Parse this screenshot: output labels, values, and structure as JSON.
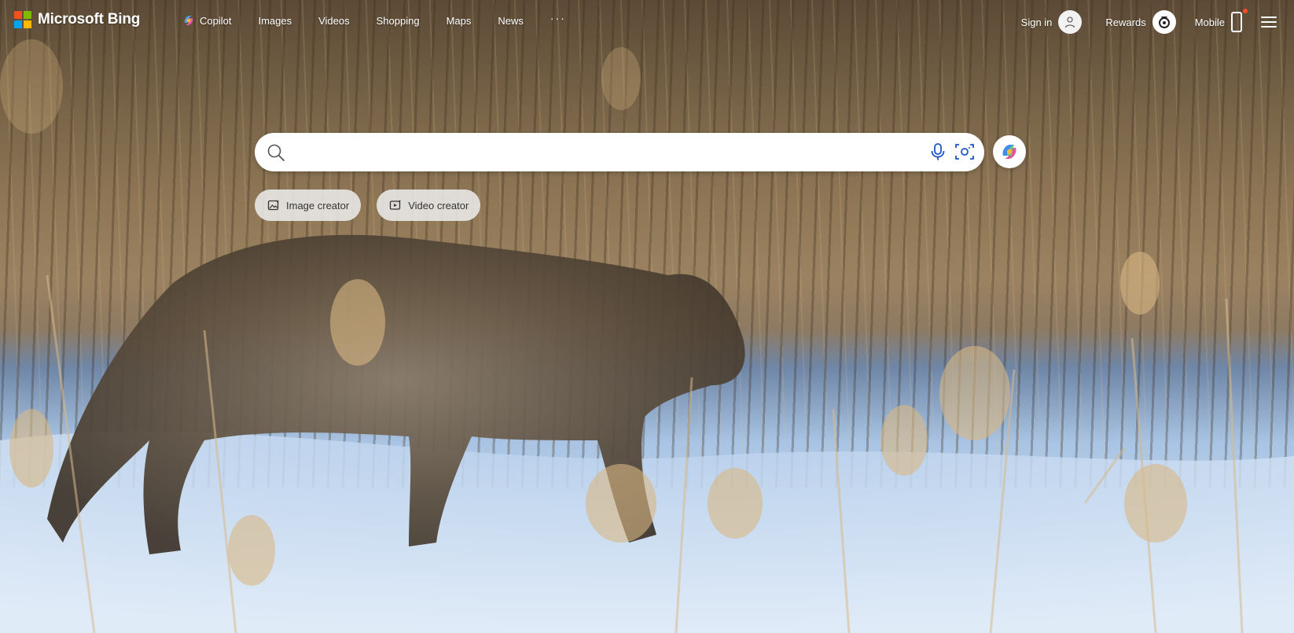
{
  "brand": {
    "name": "Microsoft Bing"
  },
  "nav": {
    "items": [
      {
        "label": "Copilot",
        "icon": "copilot-icon"
      },
      {
        "label": "Images"
      },
      {
        "label": "Videos"
      },
      {
        "label": "Shopping"
      },
      {
        "label": "Maps"
      },
      {
        "label": "News"
      }
    ],
    "more": "···"
  },
  "header_right": {
    "sign_in": "Sign in",
    "rewards": "Rewards",
    "mobile": "Mobile"
  },
  "search": {
    "value": "",
    "placeholder": ""
  },
  "chips": [
    {
      "label": "Image creator",
      "icon": "image-creator-icon"
    },
    {
      "label": "Video creator",
      "icon": "video-creator-icon"
    }
  ],
  "colors": {
    "ms_red": "#f25022",
    "ms_green": "#7fba00",
    "ms_blue": "#00a4ef",
    "ms_yellow": "#ffb900",
    "accent": "#1a56c4",
    "notification_dot": "#f25022"
  }
}
